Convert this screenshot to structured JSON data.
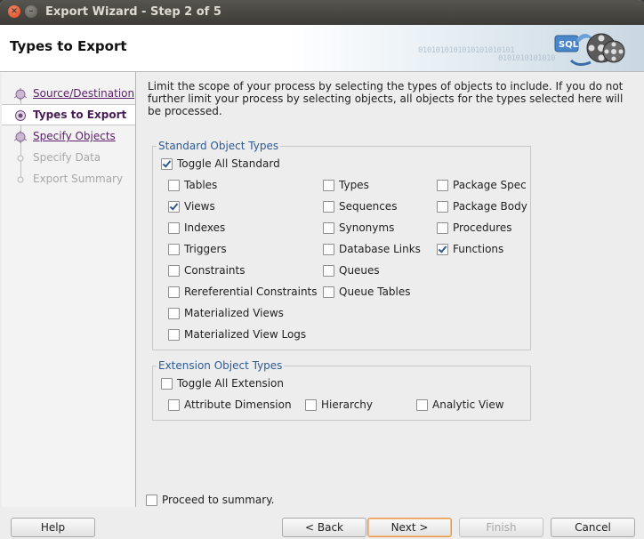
{
  "window": {
    "title": "Export Wizard - Step 2 of 5"
  },
  "header": {
    "page_title": "Types to Export",
    "binary_a": "0101010101010101010101",
    "binary_b": "0101010101010"
  },
  "steps": [
    {
      "label": "Source/Destination",
      "state": "link"
    },
    {
      "label": "Types to Export",
      "state": "current"
    },
    {
      "label": "Specify Objects",
      "state": "link"
    },
    {
      "label": "Specify Data",
      "state": "disabled"
    },
    {
      "label": "Export Summary",
      "state": "disabled"
    }
  ],
  "description": "Limit the scope of your process by selecting the types of objects to include.  If you do not further limit your process by selecting objects, all objects for the types selected here will be processed.",
  "standard": {
    "legend": "Standard Object Types",
    "toggle": {
      "label": "Toggle All Standard",
      "checked": true
    },
    "col1": [
      {
        "label": "Tables",
        "checked": false
      },
      {
        "label": "Views",
        "checked": true
      },
      {
        "label": "Indexes",
        "checked": false
      },
      {
        "label": "Triggers",
        "checked": false
      },
      {
        "label": "Constraints",
        "checked": false
      },
      {
        "label": "Rereferential Constraints",
        "checked": false
      },
      {
        "label": "Materialized Views",
        "checked": false
      },
      {
        "label": "Materialized View Logs",
        "checked": false
      }
    ],
    "col2": [
      {
        "label": "Types",
        "checked": false
      },
      {
        "label": "Sequences",
        "checked": false
      },
      {
        "label": "Synonyms",
        "checked": false
      },
      {
        "label": "Database Links",
        "checked": false
      },
      {
        "label": "Queues",
        "checked": false
      },
      {
        "label": "Queue Tables",
        "checked": false
      }
    ],
    "col3": [
      {
        "label": "Package Spec",
        "checked": false
      },
      {
        "label": "Package Body",
        "checked": false
      },
      {
        "label": "Procedures",
        "checked": false
      },
      {
        "label": "Functions",
        "checked": true
      }
    ]
  },
  "extension": {
    "legend": "Extension Object Types",
    "toggle": {
      "label": "Toggle All Extension",
      "checked": false
    },
    "items": [
      {
        "label": "Attribute Dimension",
        "checked": false
      },
      {
        "label": "Hierarchy",
        "checked": false
      },
      {
        "label": "Analytic View",
        "checked": false
      }
    ]
  },
  "proceed": {
    "label": "Proceed to summary.",
    "checked": false
  },
  "buttons": {
    "help": "Help",
    "back": "< Back",
    "next": "Next >",
    "finish": "Finish",
    "cancel": "Cancel"
  }
}
